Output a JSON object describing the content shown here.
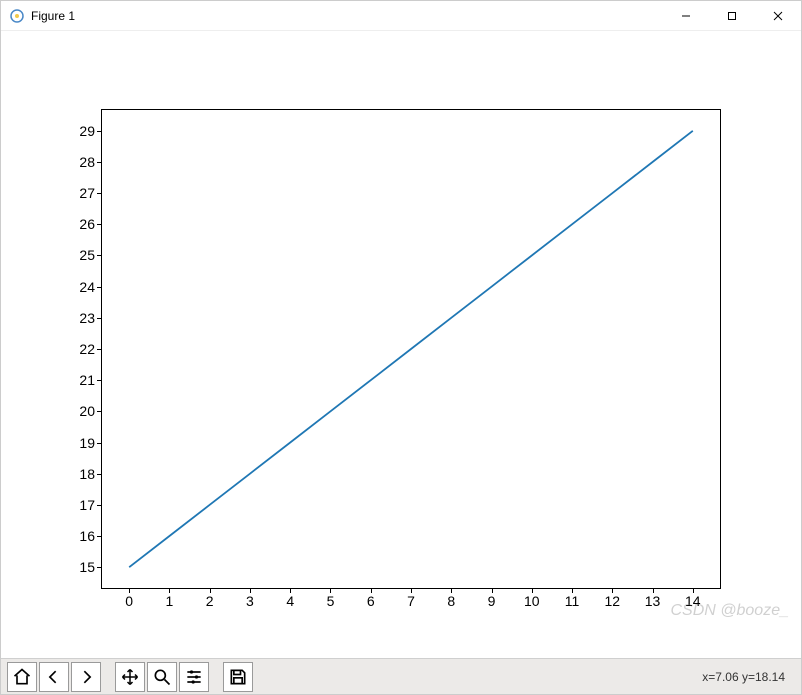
{
  "window": {
    "title": "Figure 1"
  },
  "chart_data": {
    "type": "line",
    "x": [
      0,
      1,
      2,
      3,
      4,
      5,
      6,
      7,
      8,
      9,
      10,
      11,
      12,
      13,
      14
    ],
    "values": [
      15,
      16,
      17,
      18,
      19,
      20,
      21,
      22,
      23,
      24,
      25,
      26,
      27,
      28,
      29
    ],
    "xlim": [
      -0.7,
      14.7
    ],
    "ylim": [
      14.3,
      29.7
    ],
    "xticks": [
      0,
      1,
      2,
      3,
      4,
      5,
      6,
      7,
      8,
      9,
      10,
      11,
      12,
      13,
      14
    ],
    "yticks": [
      15,
      16,
      17,
      18,
      19,
      20,
      21,
      22,
      23,
      24,
      25,
      26,
      27,
      28,
      29
    ],
    "line_color": "#1f77b4"
  },
  "toolbar": {
    "home": "Home",
    "back": "Back",
    "forward": "Forward",
    "pan": "Pan",
    "zoom": "Zoom",
    "configure": "Configure subplots",
    "save": "Save"
  },
  "status": {
    "coord_text": "x=7.06 y=18.14"
  },
  "watermark": "CSDN @booze_"
}
